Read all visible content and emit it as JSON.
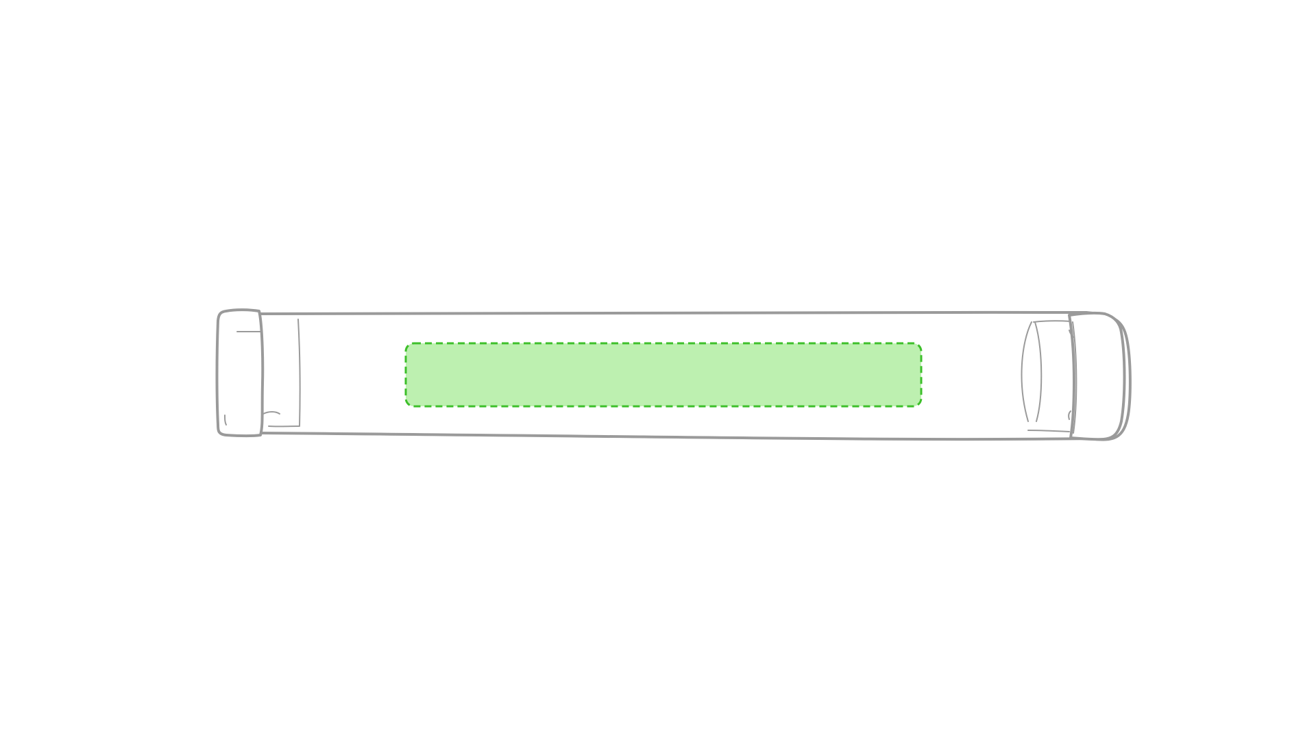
{
  "product": {
    "type": "tube case",
    "line_color": "#9a9a9a",
    "background_color": "#ffffff"
  },
  "print_area": {
    "fill_color": "#bdf0b0",
    "border_color": "#3dbf2a",
    "border_style": "dashed"
  }
}
